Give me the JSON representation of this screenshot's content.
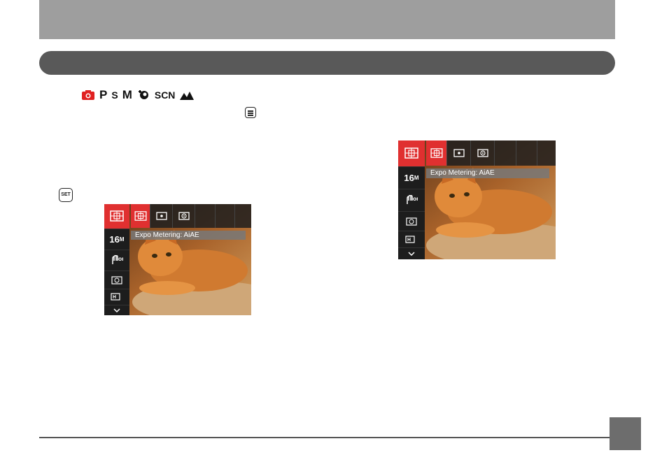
{
  "modes": {
    "p": "P",
    "s": "S",
    "m": "M",
    "scn": "SCN"
  },
  "set_button": "SET",
  "screens": [
    {
      "resolution_label": "16",
      "resolution_sub": "M",
      "metering_label": "Expo Metering: AiAE"
    },
    {
      "resolution_label": "16",
      "resolution_sub": "M",
      "metering_label": "Expo Metering: AiAE"
    }
  ],
  "colors": {
    "accent": "#e03030",
    "header_bar": "#9e9e9e",
    "section_pill": "#595959",
    "page_box": "#6d6d6d"
  }
}
